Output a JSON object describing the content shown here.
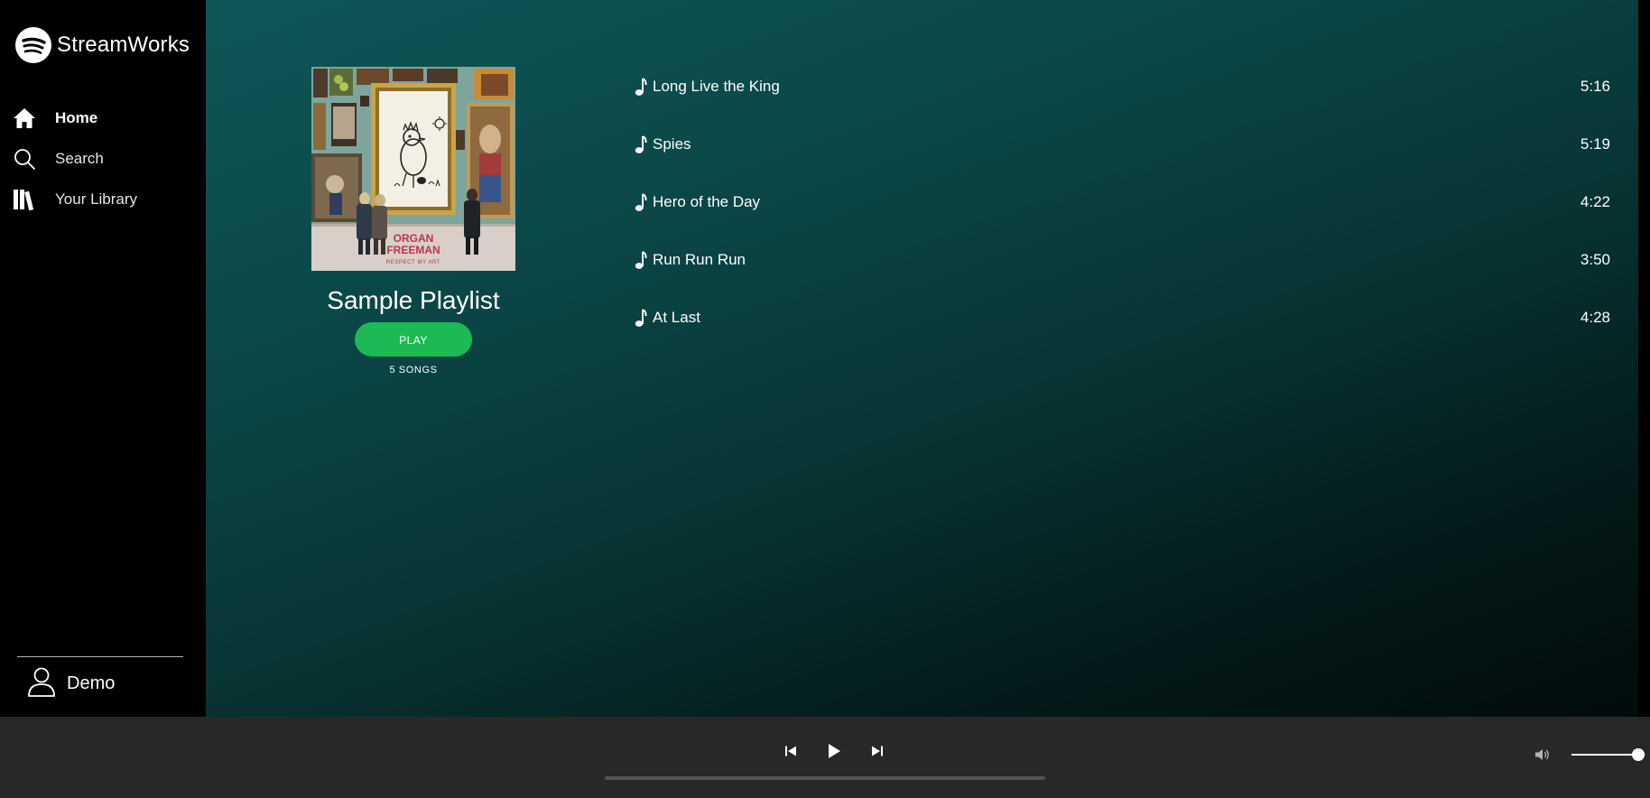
{
  "brand": {
    "name": "StreamWorks",
    "logo_icon": "streamworks-logo-icon"
  },
  "sidebar": {
    "items": [
      {
        "label": "Home",
        "icon": "home-icon",
        "active": true
      },
      {
        "label": "Search",
        "icon": "search-icon",
        "active": false
      },
      {
        "label": "Your Library",
        "icon": "library-icon",
        "active": false
      }
    ],
    "user": {
      "label": "Demo",
      "icon": "user-icon"
    }
  },
  "playlist": {
    "title": "Sample Playlist",
    "play_label": "PLAY",
    "song_count": "5 SONGS",
    "cover_title_line1": "ORGAN",
    "cover_title_line2": "FREEMAN",
    "cover_subtitle": "RESPECT MY ART"
  },
  "tracks": [
    {
      "title": "Long Live the King",
      "duration": "5:16"
    },
    {
      "title": "Spies",
      "duration": "5:19"
    },
    {
      "title": "Hero of the Day",
      "duration": "4:22"
    },
    {
      "title": "Run Run Run",
      "duration": "3:50"
    },
    {
      "title": "At Last",
      "duration": "4:28"
    }
  ],
  "player": {
    "controls": [
      "previous-icon",
      "play-icon",
      "next-icon"
    ],
    "progress": 0,
    "volume": 0.9,
    "volume_icon": "volume-icon"
  },
  "colors": {
    "accent": "#1db954",
    "sidebar_bg": "#000000",
    "player_bg": "#282828",
    "main_gradient_top": "#0e5757",
    "main_gradient_bottom": "#020b0b"
  }
}
